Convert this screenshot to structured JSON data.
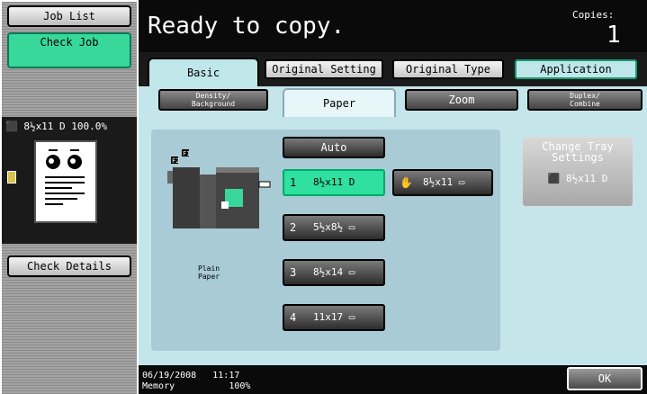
{
  "left_panel": {
    "job_list_label": "Job List",
    "check_job_label": "Check Job",
    "preview_header": "⬛ 8½x11 D  100.0%",
    "check_details_label": "Check Details"
  },
  "header": {
    "status": "Ready to copy.",
    "copies_label": "Copies:",
    "copies_value": "1"
  },
  "tabs": {
    "basic": "Basic",
    "original_setting": "Original Setting",
    "original_type": "Original Type",
    "application": "Application"
  },
  "subtabs": {
    "density_line1": "Density/",
    "density_line2": "Background",
    "paper": "Paper",
    "zoom": "Zoom",
    "duplex_line1": "Duplex/",
    "duplex_line2": "Combine"
  },
  "paper": {
    "auto": "Auto",
    "tray1_num": "1",
    "tray1_size": "8½x11 D",
    "bypass_size": "8½x11 ▭",
    "tray2_num": "2",
    "tray2_size": "5½x8½ ▭",
    "tray3_num": "3",
    "tray3_size": "8½x14 ▭",
    "tray4_num": "4",
    "tray4_size": "11x17 ▭",
    "paper_type_line1": "Plain",
    "paper_type_line2": "Paper",
    "change_tray_line1": "Change Tray",
    "change_tray_line2": "Settings",
    "change_tray_size": "⬛ 8½x11 D",
    "machine_labels": [
      "F2",
      "F1"
    ]
  },
  "footer": {
    "date_time": "06/19/2008   11:17",
    "memory": "Memory          100%",
    "ok_label": "OK"
  },
  "colors": {
    "accent_green": "#2fe0a0",
    "content_bg": "#c4e5ea",
    "panel_bg": "#a9cbd6"
  }
}
